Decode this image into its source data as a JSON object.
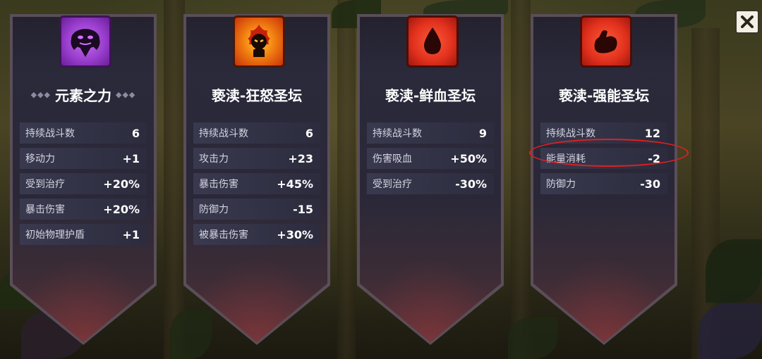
{
  "cards": [
    {
      "icon": "elemental-face-icon",
      "icon_color": "#9a3fcf",
      "title": "元素之力",
      "stats": [
        {
          "label": "持续战斗数",
          "value": "6"
        },
        {
          "label": "移动力",
          "value": "+1"
        },
        {
          "label": "受到治疗",
          "value": "+20%"
        },
        {
          "label": "暴击伤害",
          "value": "+20%"
        },
        {
          "label": "初始物理护盾",
          "value": "+1"
        }
      ]
    },
    {
      "icon": "rage-flame-icon",
      "icon_color": "#f07a10",
      "title": "亵渎-狂怒圣坛",
      "stats": [
        {
          "label": "持续战斗数",
          "value": "6"
        },
        {
          "label": "攻击力",
          "value": "+23"
        },
        {
          "label": "暴击伤害",
          "value": "+45%"
        },
        {
          "label": "防御力",
          "value": "-15"
        },
        {
          "label": "被暴击伤害",
          "value": "+30%"
        }
      ]
    },
    {
      "icon": "blood-drop-icon",
      "icon_color": "#e0301c",
      "title": "亵渎-鲜血圣坛",
      "stats": [
        {
          "label": "持续战斗数",
          "value": "9"
        },
        {
          "label": "伤害吸血",
          "value": "+50%"
        },
        {
          "label": "受到治疗",
          "value": "-30%"
        }
      ]
    },
    {
      "icon": "flexed-arm-icon",
      "icon_color": "#e0301c",
      "title": "亵渎-强能圣坛",
      "stats": [
        {
          "label": "持续战斗数",
          "value": "12"
        },
        {
          "label": "能量消耗",
          "value": "-2"
        },
        {
          "label": "防御力",
          "value": "-30"
        }
      ]
    }
  ],
  "title_ornament": "◆◆◆",
  "close_icon": "close-icon",
  "highlight_color": "#e02020"
}
